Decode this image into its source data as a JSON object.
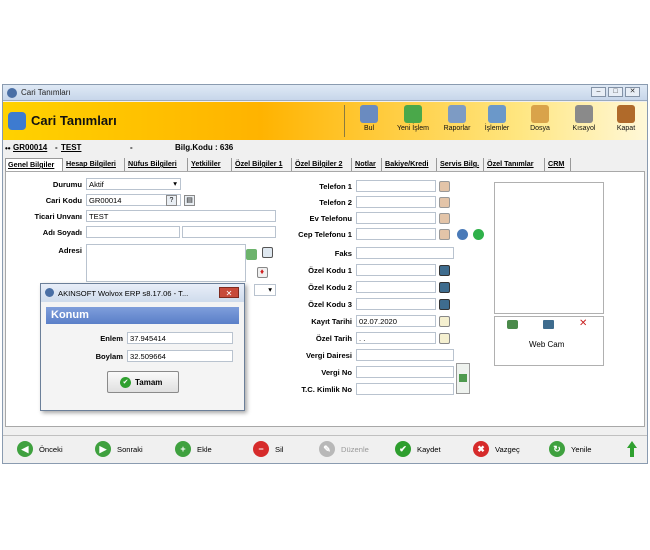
{
  "window": {
    "title": "Cari Tanımları"
  },
  "header": {
    "title": "Cari Tanımları",
    "toolbar": [
      {
        "label": "Bul",
        "icon": "search-person-icon"
      },
      {
        "label": "Yeni İşlem",
        "icon": "plus-circle-icon"
      },
      {
        "label": "Raporlar",
        "icon": "report-icon"
      },
      {
        "label": "İşlemler",
        "icon": "list-icon"
      },
      {
        "label": "Dosya",
        "icon": "folder-icon"
      },
      {
        "label": "Kısayol",
        "icon": "keyboard-icon"
      },
      {
        "label": "Kapat",
        "icon": "door-icon"
      }
    ]
  },
  "infobar": {
    "code": "GR00014",
    "sep": "-",
    "name": "TEST",
    "dash": "-",
    "bilg": "Bilg.Kodu : 636"
  },
  "tabs": [
    "Genel Bilgiler",
    "Hesap Bilgileri",
    "Nüfus Bilgileri",
    "Yetkililer",
    "Özel Bilgiler 1",
    "Özel Bilgiler 2",
    "Notlar",
    "Bakiye/Kredi",
    "Servis Bilg.",
    "Özel Tanımlar",
    "CRM"
  ],
  "left_form": {
    "durum_label": "Durumu",
    "durum_value": "Aktif",
    "kod_label": "Cari Kodu",
    "kod_value": "GR00014",
    "unvan_label": "Ticari Unvanı",
    "unvan_value": "TEST",
    "adsoyad_label": "Adı Soyadı",
    "adres_label": "Adresi"
  },
  "right_form": {
    "tel1": "Telefon 1",
    "tel2": "Telefon 2",
    "evtel": "Ev Telefonu",
    "cep": "Cep Telefonu 1",
    "faks": "Faks",
    "ozel1": "Özel Kodu 1",
    "ozel2": "Özel Kodu 2",
    "ozel3": "Özel Kodu 3",
    "kayit_label": "Kayıt Tarihi",
    "kayit_value": "02.07.2020",
    "ozeltarih_label": "Özel Tarih",
    "ozeltarih_value": ". .",
    "vd": "Vergi Dairesi",
    "vn": "Vergi No",
    "tc": "T.C. Kimlik No"
  },
  "webcam": {
    "label": "Web Cam"
  },
  "navbar": [
    {
      "label": "Önceki",
      "color": "#3fa13f",
      "glyph": "◀"
    },
    {
      "label": "Sonraki",
      "color": "#3fa13f",
      "glyph": "▶"
    },
    {
      "label": "Ekle",
      "color": "#3fa13f",
      "glyph": "+"
    },
    {
      "label": "Sil",
      "color": "#d62b2b",
      "glyph": "−"
    },
    {
      "label": "Düzenle",
      "color": "#b8b8b8",
      "glyph": "✎"
    },
    {
      "label": "Kaydet",
      "color": "#2e9e2e",
      "glyph": "✔"
    },
    {
      "label": "Vazgeç",
      "color": "#d62b2b",
      "glyph": "✖"
    },
    {
      "label": "Yenile",
      "color": "#3fa13f",
      "glyph": "↻"
    }
  ],
  "dialog": {
    "title": "AKINSOFT Wolvox ERP s8.17.06 - T...",
    "header": "Konum",
    "enlem_label": "Enlem",
    "enlem_value": "37.945414",
    "boylam_label": "Boylam",
    "boylam_value": "32.509664",
    "ok_label": "Tamam"
  }
}
